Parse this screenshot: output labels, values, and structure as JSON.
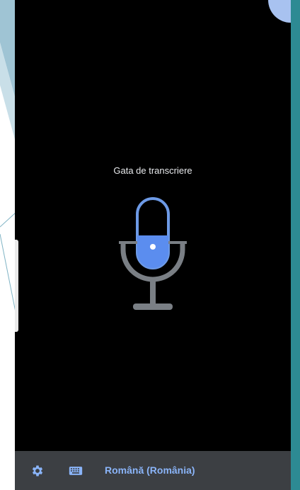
{
  "voice_typing": {
    "status": "Gata de transcriere",
    "state": "ready"
  },
  "bottom_bar": {
    "settings_icon": "gear-icon",
    "keyboard_icon": "keyboard-icon",
    "language": "Română (România)"
  },
  "colors": {
    "panel_background": "#000000",
    "bottom_bar_background": "#3c3f43",
    "accent_blue": "#5b8def",
    "mic_stand_gray": "#7a7f85",
    "language_text": "#8ab4f8",
    "status_text": "#e8eaed",
    "right_edge_teal": "#2d8a93"
  }
}
